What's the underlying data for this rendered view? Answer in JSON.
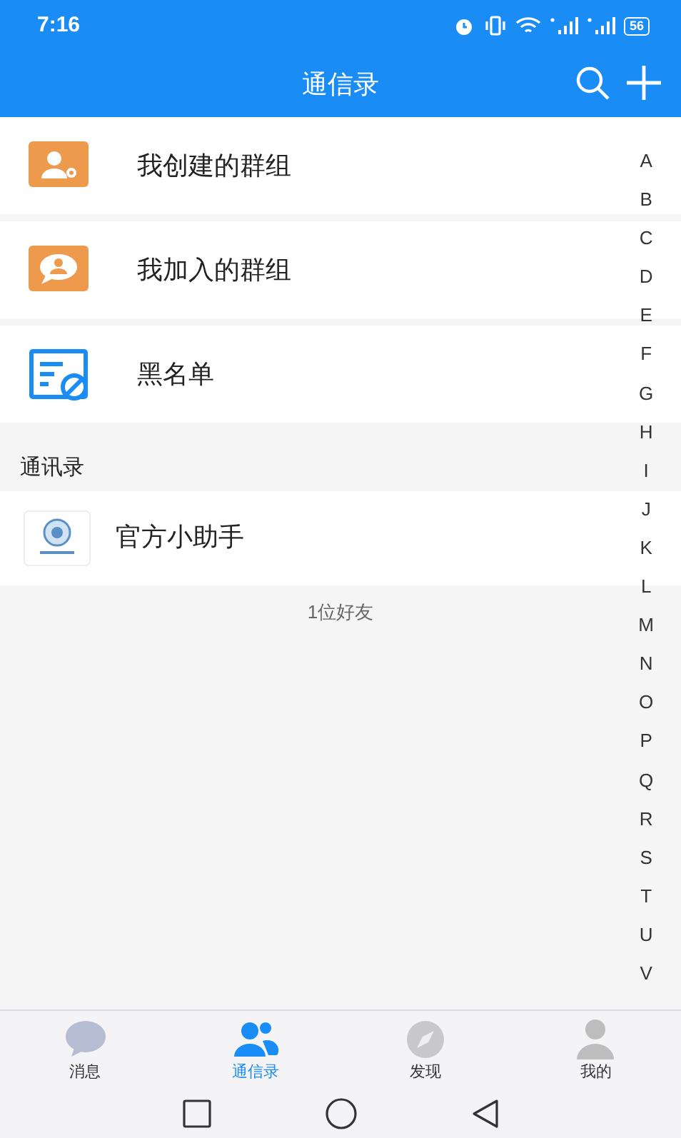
{
  "status_bar": {
    "time": "7:16",
    "battery": "56"
  },
  "header": {
    "title": "通信录"
  },
  "shortcuts": [
    {
      "kind": "created",
      "label": "我创建的群组"
    },
    {
      "kind": "joined",
      "label": "我加入的群组"
    },
    {
      "kind": "blacklist",
      "label": "黑名单"
    }
  ],
  "section": {
    "title": "通讯录"
  },
  "contacts": [
    {
      "name": "官方小助手"
    }
  ],
  "friend_count": "1位好友",
  "index_letters": [
    "A",
    "B",
    "C",
    "D",
    "E",
    "F",
    "G",
    "H",
    "I",
    "J",
    "K",
    "L",
    "M",
    "N",
    "O",
    "P",
    "Q",
    "R",
    "S",
    "T",
    "U",
    "V"
  ],
  "tabs": [
    {
      "kind": "messages",
      "label": "消息",
      "selected": false
    },
    {
      "kind": "contacts",
      "label": "通信录",
      "selected": true
    },
    {
      "kind": "discover",
      "label": "发现",
      "selected": false
    },
    {
      "kind": "me",
      "label": "我的",
      "selected": false
    }
  ]
}
